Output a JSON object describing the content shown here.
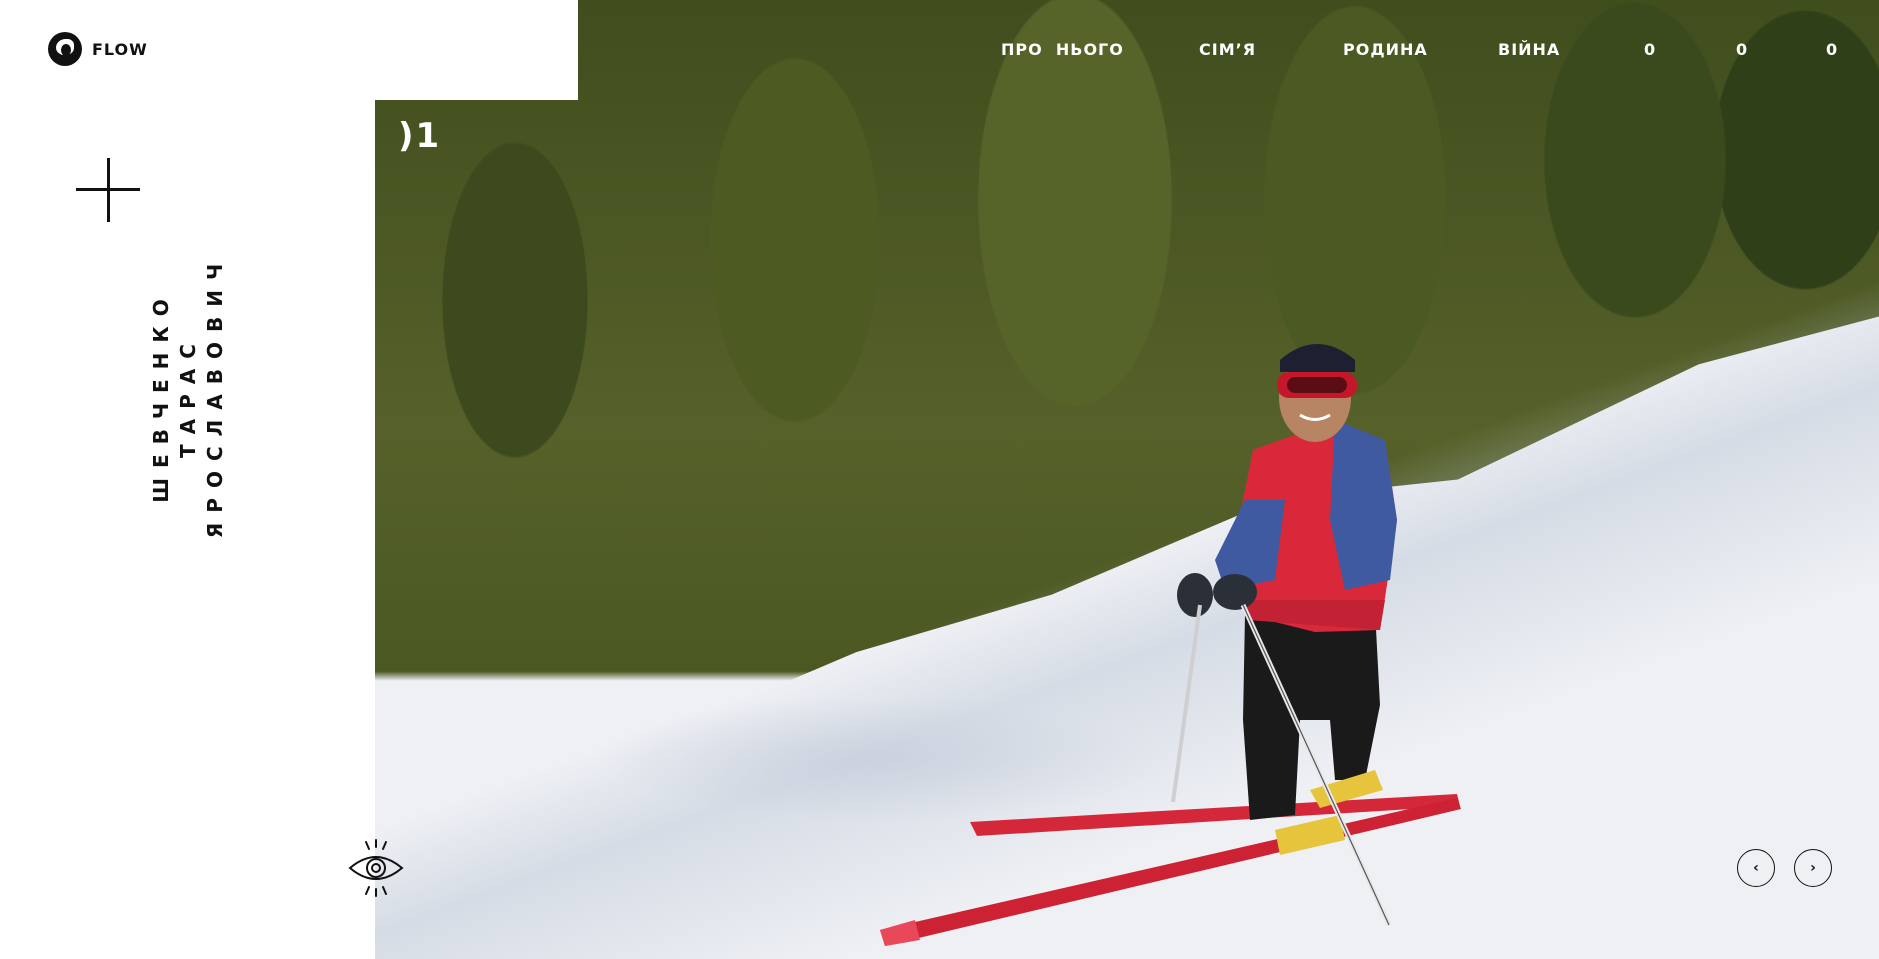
{
  "brand": {
    "name": "FLOW",
    "icon": "dog-head-logo-icon"
  },
  "nav": {
    "items": [
      {
        "label": "ПРО  НЬОГО"
      },
      {
        "label": "СІМ’Я"
      },
      {
        "label": "РОДИНА"
      },
      {
        "label": "ВІЙНА"
      },
      {
        "label": "0"
      },
      {
        "label": "0"
      },
      {
        "label": "0"
      }
    ]
  },
  "hero": {
    "slide_number": ")1",
    "image_description_icon": "skier-photo"
  },
  "person": {
    "surname": "ШЕВЧЕНКО",
    "given_name": "ТАРАС",
    "patronymic": "ЯРОСЛАВОВИЧ"
  },
  "controls": {
    "plus_icon": "plus-icon",
    "eye_icon": "eye-icon",
    "prev_label": "‹",
    "next_label": "›"
  },
  "colors": {
    "background": "#ffffff",
    "text": "#111111",
    "nav_text": "#ffffff",
    "jacket_red": "#d8283a",
    "jacket_blue": "#3f5aa0"
  }
}
